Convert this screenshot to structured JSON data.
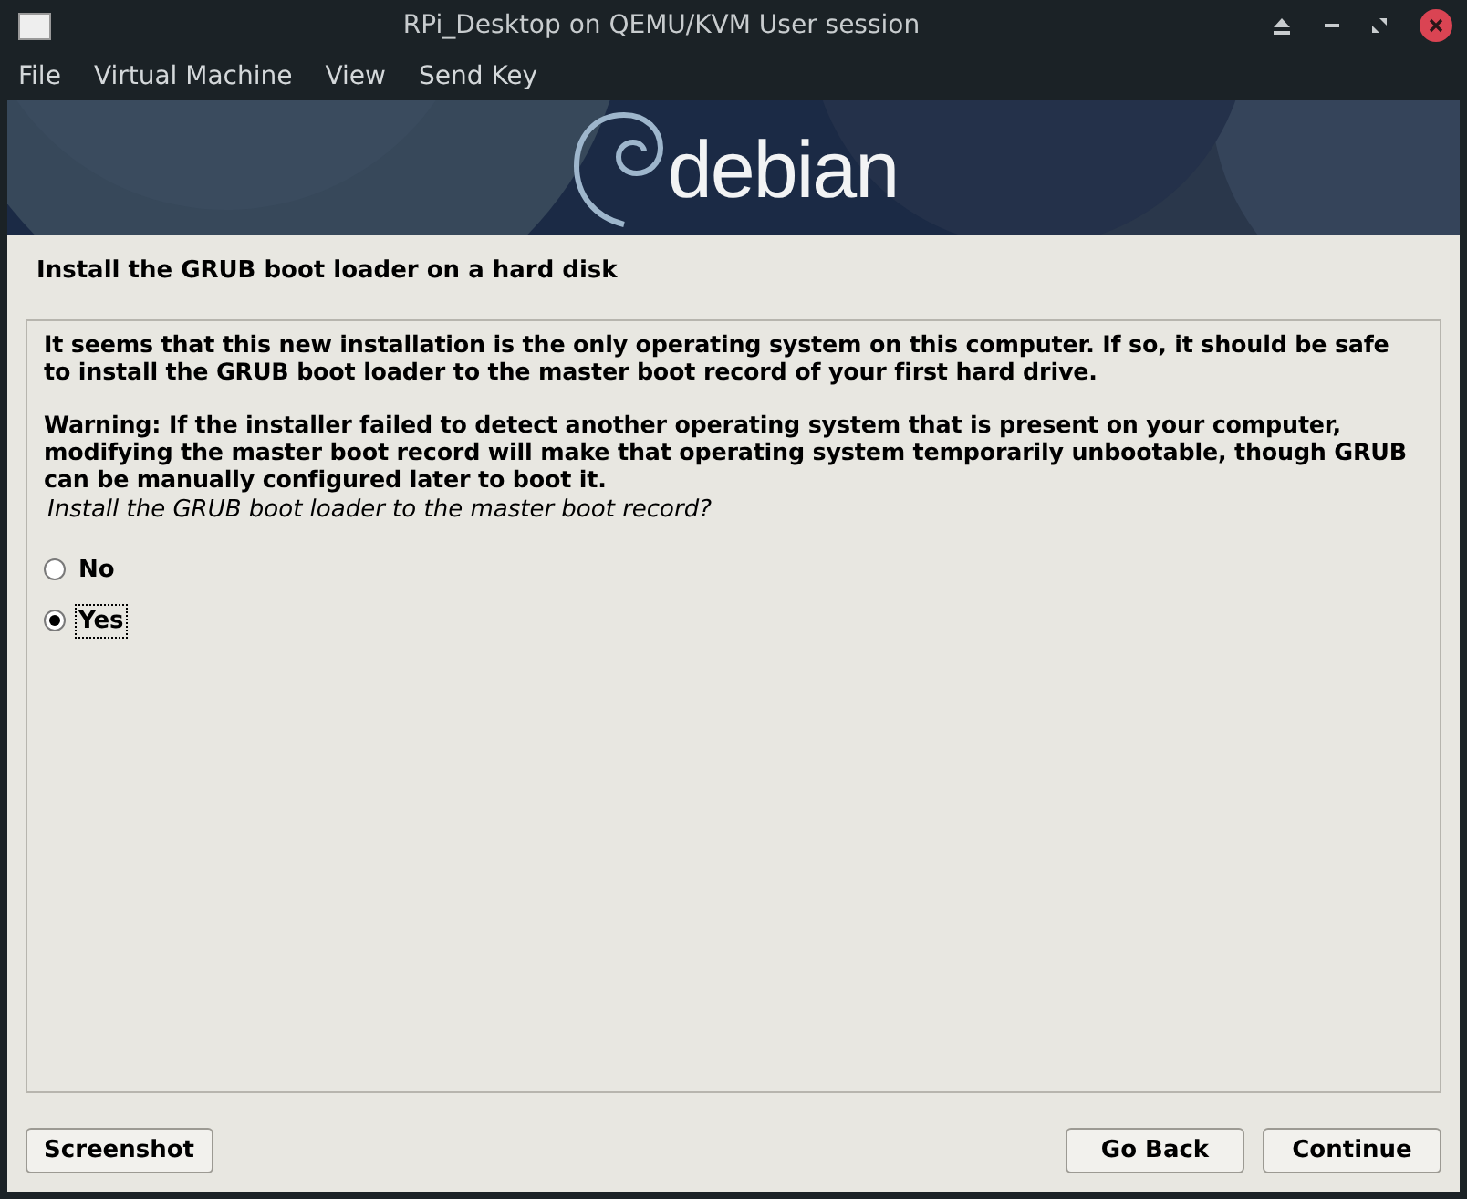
{
  "window": {
    "title": "RPi_Desktop on QEMU/KVM User session"
  },
  "menu": [
    "File",
    "Virtual Machine",
    "View",
    "Send Key"
  ],
  "banner": {
    "logo_text": "debian"
  },
  "heading": "Install the GRUB boot loader on a hard disk",
  "paragraphs": [
    "It seems that this new installation is the only operating system on this computer. If so, it should be safe to install the GRUB boot loader to the master boot record of your first hard drive.",
    "Warning: If the installer failed to detect another operating system that is present on your computer, modifying the master boot record will make that operating system temporarily unbootable, though GRUB can be manually configured later to boot it."
  ],
  "question": "Install the GRUB boot loader to the master boot record?",
  "options": [
    {
      "label": "No",
      "selected": false
    },
    {
      "label": "Yes",
      "selected": true
    }
  ],
  "buttons": {
    "left": [
      "Screenshot"
    ],
    "right": [
      "Go Back",
      "Continue"
    ]
  }
}
